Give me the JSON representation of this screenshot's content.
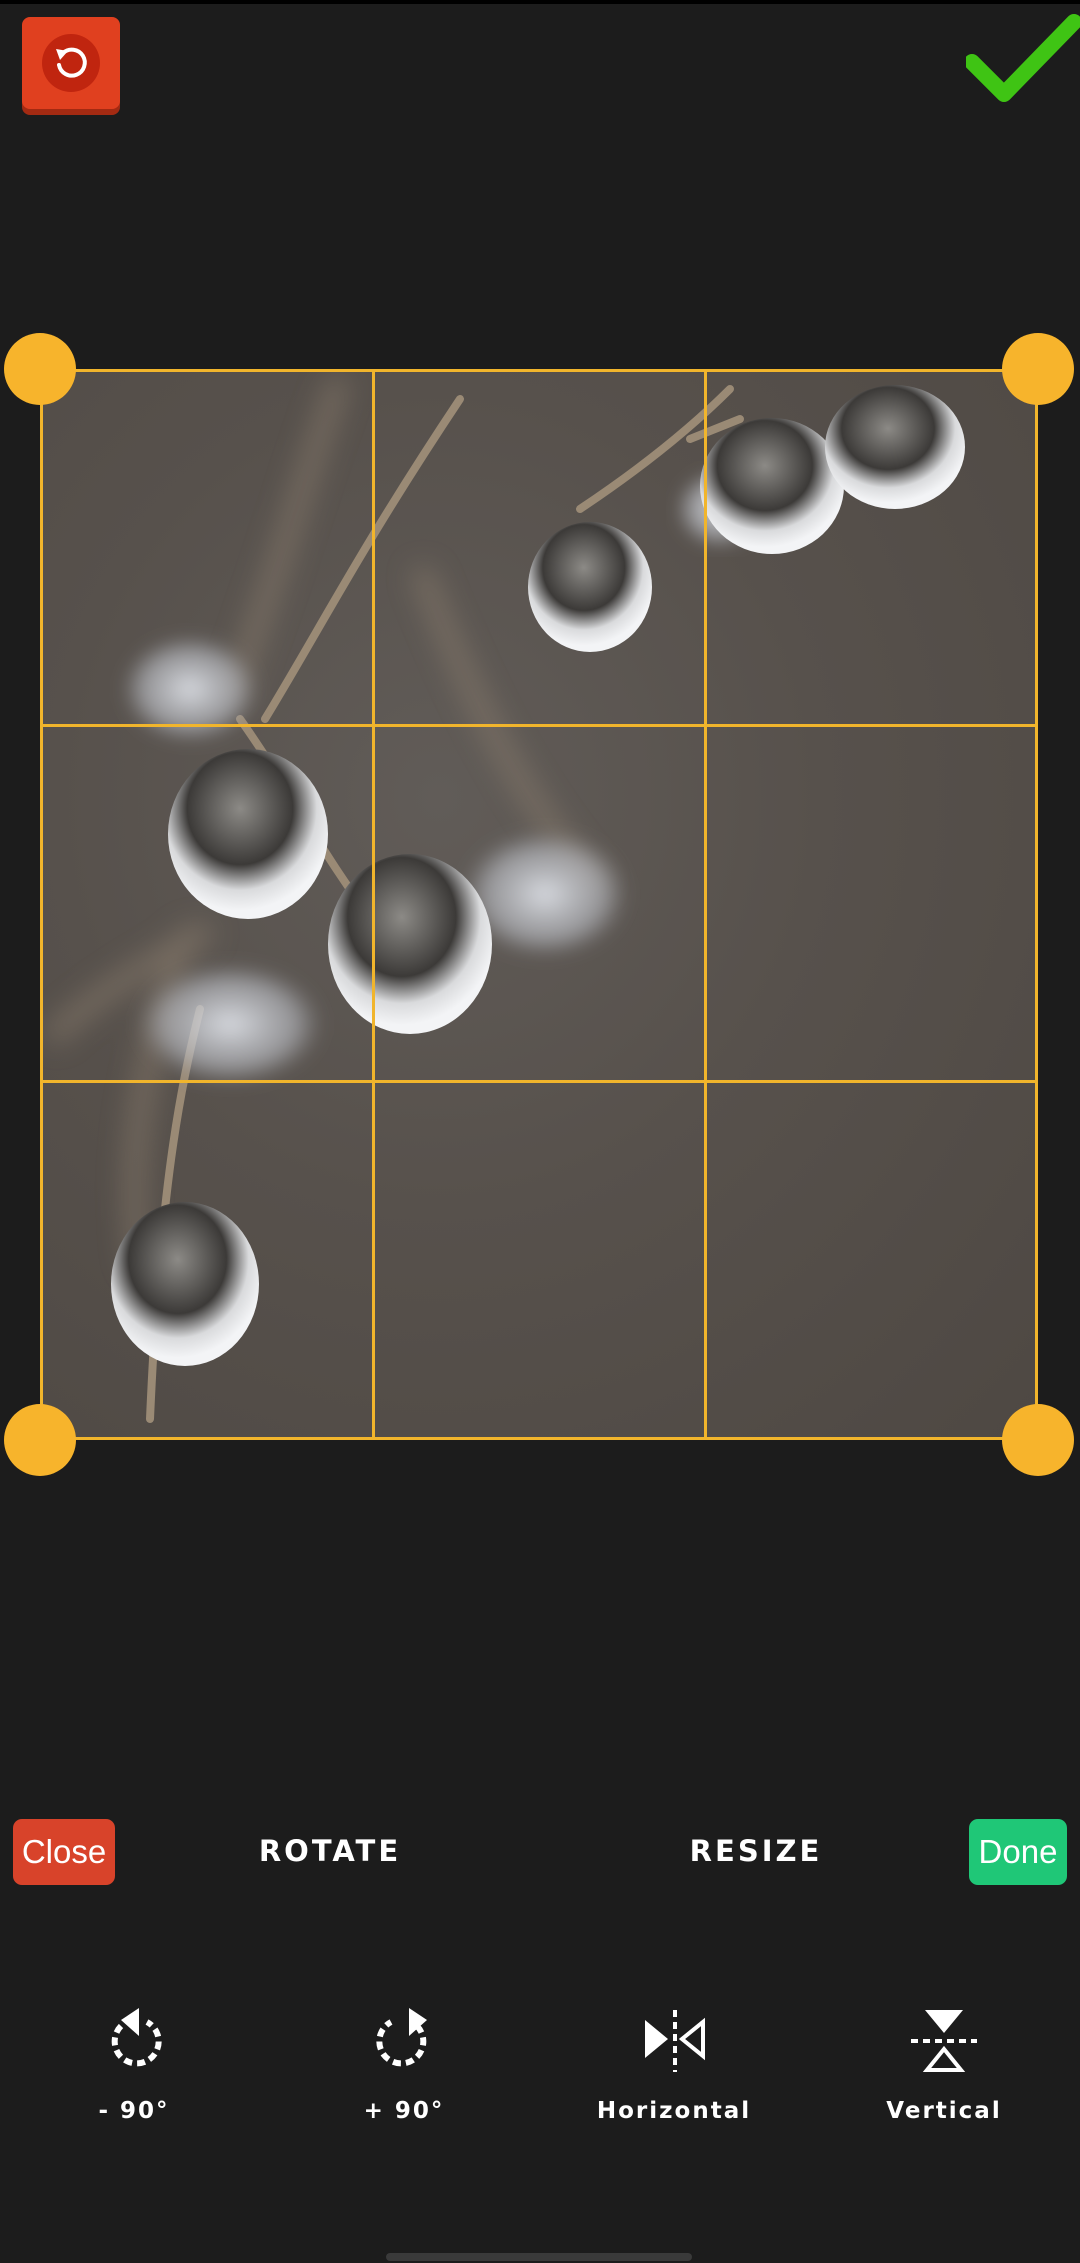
{
  "topbar": {
    "reset_icon": "reset-rotate-icon",
    "confirm_icon": "checkmark-icon"
  },
  "crop": {
    "grid_color": "#f1b52c",
    "handle_color": "#f7b42c"
  },
  "bottombar": {
    "close_label": "Close",
    "rotate_tab": "ROTATE",
    "resize_tab": "RESIZE",
    "done_label": "Done"
  },
  "tools": [
    {
      "label": "- 90°",
      "icon": "rotate-left-icon"
    },
    {
      "label": "+ 90°",
      "icon": "rotate-right-icon"
    },
    {
      "label": "Horizontal",
      "icon": "flip-horizontal-icon"
    },
    {
      "label": "Vertical",
      "icon": "flip-vertical-icon"
    }
  ],
  "colors": {
    "background": "#1c1c1c",
    "close_button": "#d8432a",
    "done_button": "#1fc777",
    "reset_button": "#e0401f",
    "check": "#3fc414"
  }
}
